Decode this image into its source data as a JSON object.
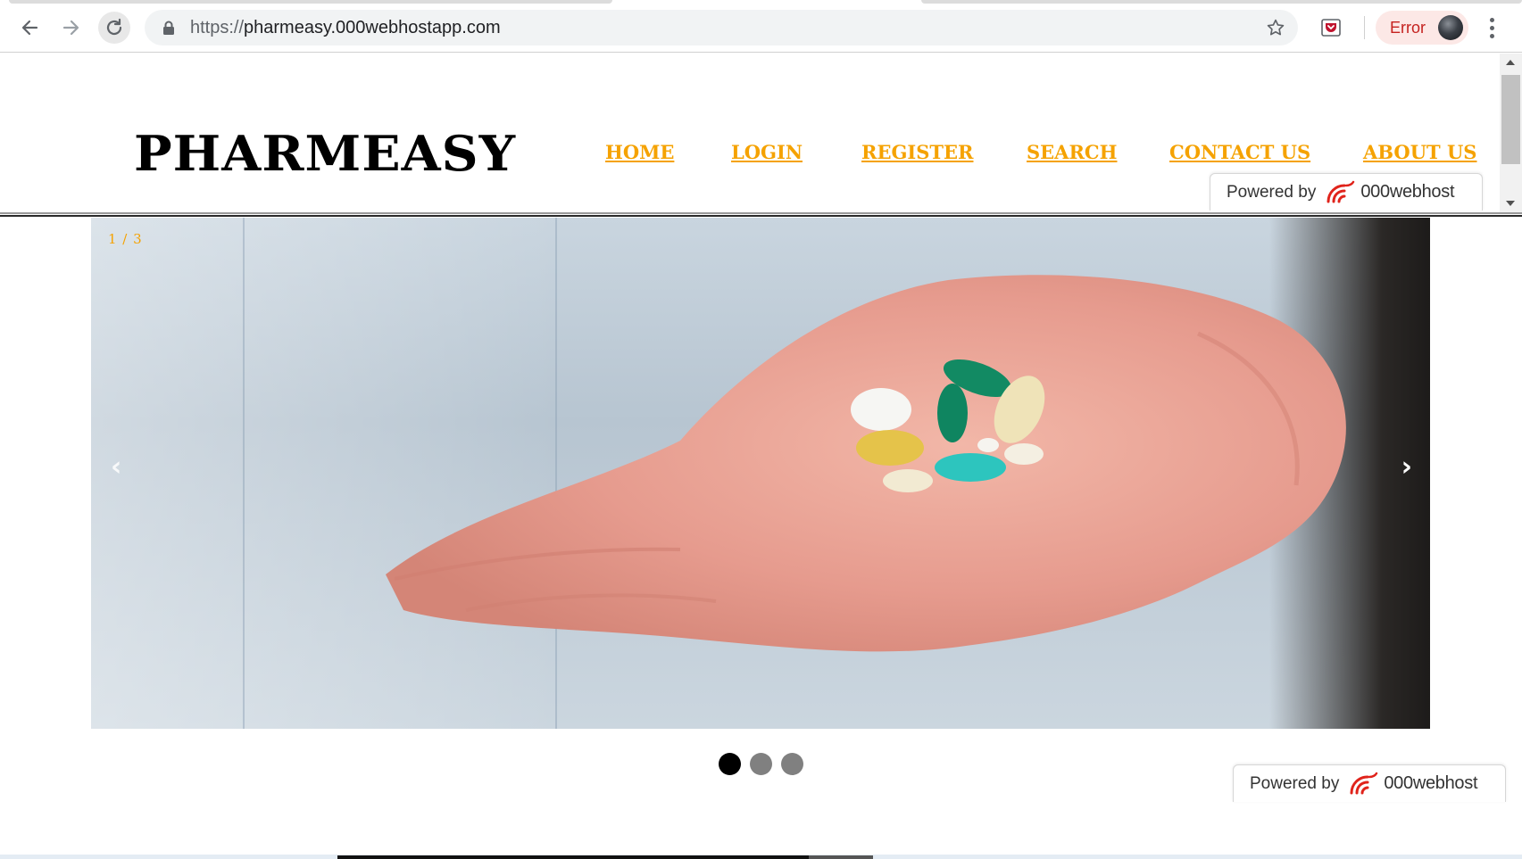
{
  "browser": {
    "url_scheme": "https://",
    "url_host": "pharmeasy.000webhostapp.com",
    "profile_status": "Error",
    "icons": {
      "back": "arrow-left-icon",
      "forward": "arrow-right-icon",
      "reload": "reload-icon",
      "lock": "lock-icon",
      "bookmark": "star-icon",
      "extension": "pocket-icon",
      "menu": "kebab-menu-icon"
    }
  },
  "site": {
    "logo": "PHARMEASY",
    "nav": [
      {
        "label": "HOME"
      },
      {
        "label": "LOGIN"
      },
      {
        "label": "REGISTER"
      },
      {
        "label": "SEARCH"
      },
      {
        "label": "CONTACT US"
      },
      {
        "label": "ABOUT US"
      }
    ],
    "accent_color": "#f5a200"
  },
  "slideshow": {
    "counter": "1 / 3",
    "prev_glyph": "‹",
    "next_glyph": "›",
    "image_description_icon": "hand-holding-pills-image",
    "dots": [
      {
        "active": true
      },
      {
        "active": false
      },
      {
        "active": false
      }
    ]
  },
  "badge": {
    "prefix": "Powered by",
    "brand": "000webhost"
  }
}
